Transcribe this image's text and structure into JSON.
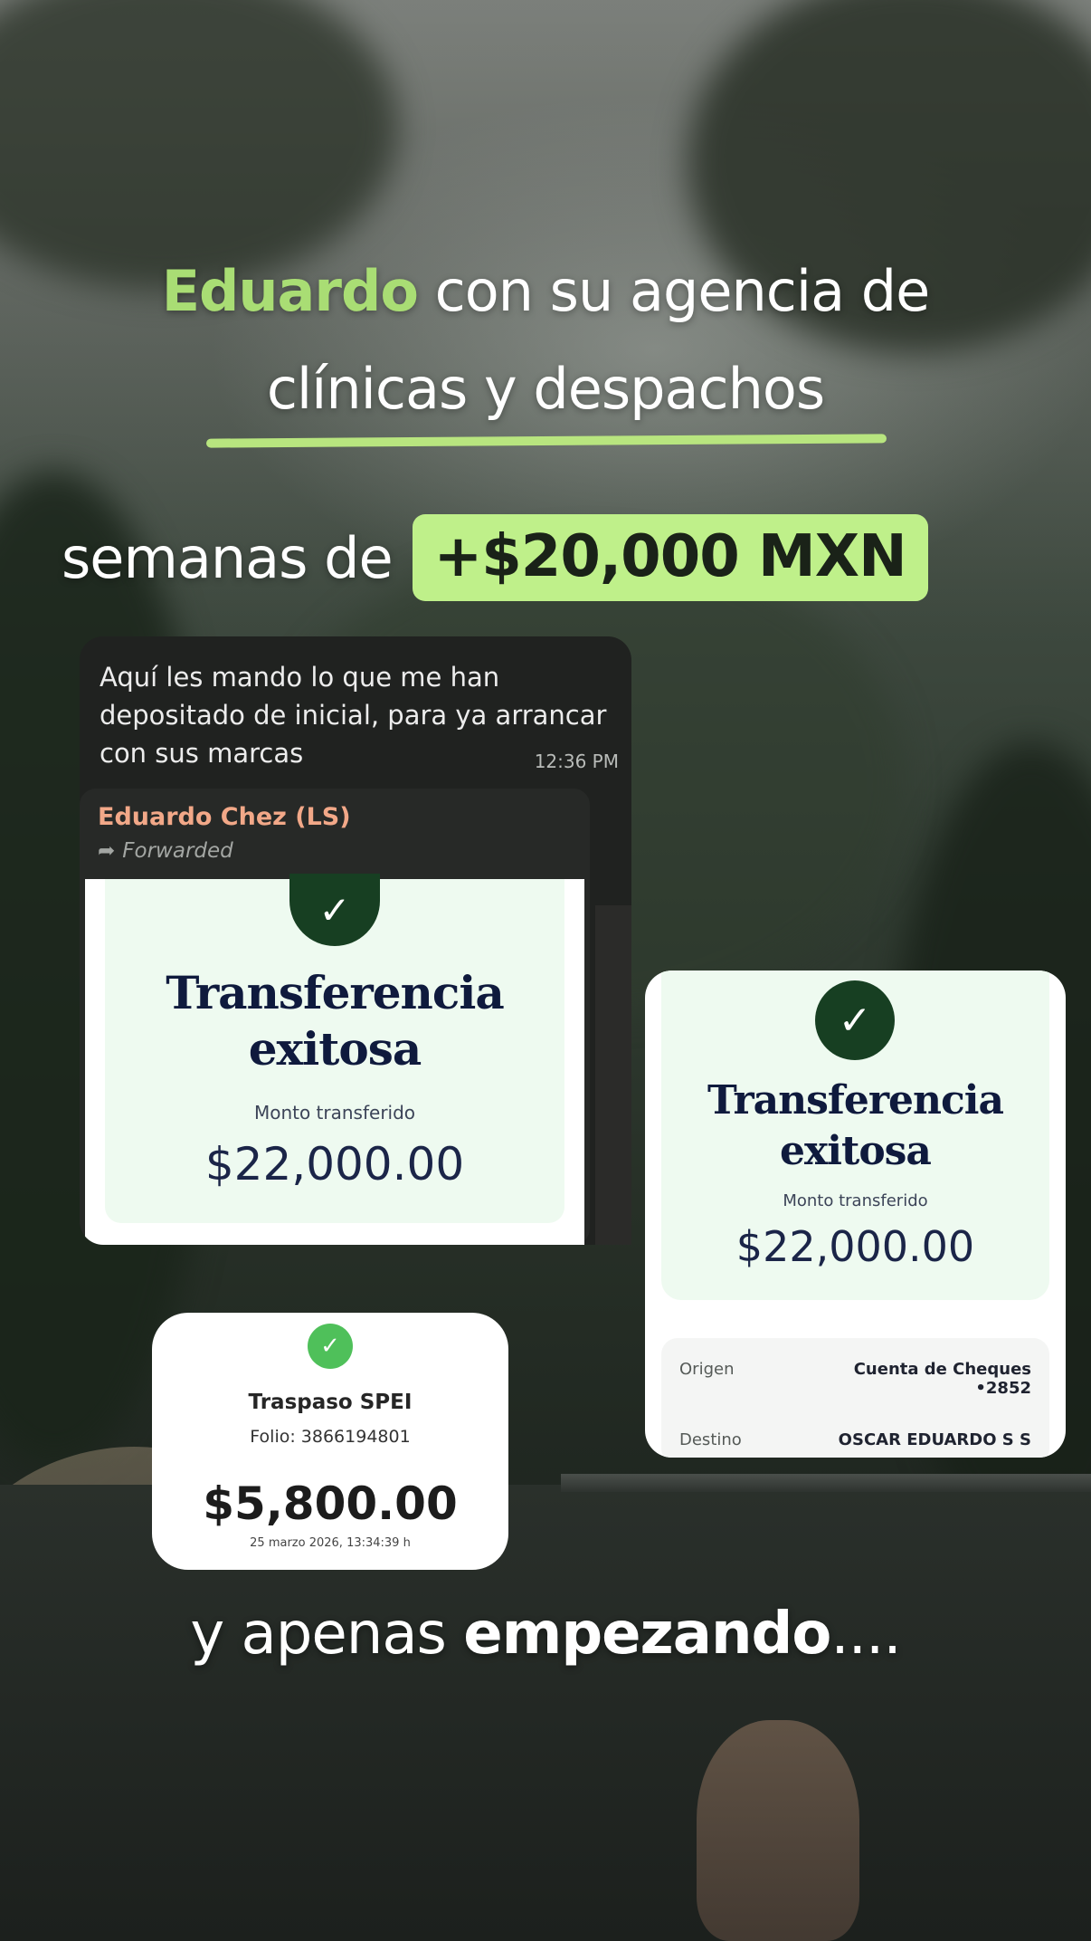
{
  "headline": {
    "line1_highlight": "Eduardo",
    "line1_rest": " con su agencia de",
    "line2": "clínicas y despachos",
    "line3_prefix": "semanas de",
    "line3_pill": "+$20,000 MXN",
    "highlight_color": "#a9dd74",
    "pill_color": "#bff08a"
  },
  "chat": {
    "message": "Aquí les mando lo que me han depositado de inicial, para ya arrancar con sus marcas",
    "time": "12:36 PM",
    "sender": "Eduardo Chez (LS)",
    "forwarded_label": "Forwarded",
    "forwarded_icon": "forward-arrow-icon",
    "transfer": {
      "check_icon": "check-icon",
      "title_line1": "Transferencia",
      "title_line2": "exitosa",
      "subtitle": "Monto transferido",
      "amount": "$22,000.00"
    }
  },
  "right_card": {
    "check_icon": "check-icon",
    "title_line1": "Transferencia",
    "title_line2": "exitosa",
    "subtitle": "Monto transferido",
    "amount": "$22,000.00",
    "origin_label": "Origen",
    "origin_value_line1": "Cuenta de Cheques",
    "origin_value_line2": "•2852",
    "dest_label": "Destino",
    "dest_value": "OSCAR EDUARDO S S"
  },
  "spei_card": {
    "check_icon": "check-icon",
    "title": "Traspaso SPEI",
    "folio": "Folio: 3866194801",
    "amount": "$5,800.00",
    "date": "25 marzo 2026, 13:34:39 h"
  },
  "footer": {
    "prefix": "y apenas ",
    "bold": "empezando",
    "suffix": "...."
  }
}
